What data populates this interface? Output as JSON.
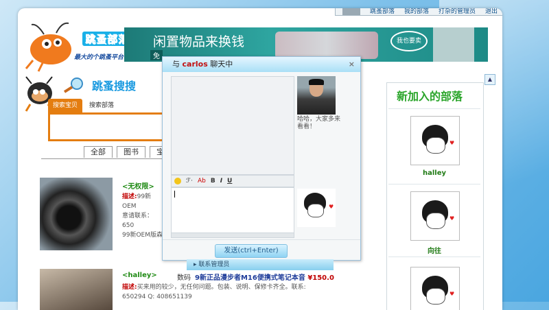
{
  "topnav": {
    "items": [
      "跳蚤部落",
      "我的部落",
      "打杂的管理员",
      "退出"
    ]
  },
  "header": {
    "logo_title": "跳蚤部落",
    "logo_sub": "最大的个跳蚤平台",
    "banner_text": "闲置物品来换钱",
    "banner_sub": "免",
    "banner_button": "我也要卖"
  },
  "search": {
    "title": "跳蚤搜搜",
    "tabs": [
      "搜索宝贝",
      "搜索部落"
    ]
  },
  "category_tabs": [
    "全部",
    "图书",
    "宝马"
  ],
  "items": [
    {
      "user": "<无权限>",
      "desc_label": "描述:",
      "desc_text": "99新OEM",
      "contact": "意请联系：650",
      "footer": "99新OEM版森"
    },
    {
      "user": "<halley>",
      "prefix": "数码",
      "title": "9新正品漫步者M16便携式笔记本音",
      "price": "¥150.0",
      "desc_label": "描述:",
      "desc_text": "买来用的较少，无任何问题。包装、说明、保修卡齐全。联系:",
      "contact": "650294 Q: 408651139"
    }
  ],
  "right_panel": {
    "title": "新加入的部落",
    "members": [
      "halley",
      "向往",
      ""
    ]
  },
  "chat": {
    "title_prefix": "与",
    "username": "carlos",
    "title_suffix": "聊天中",
    "close": "×",
    "peer_message": "哈哈，大家多来看看！",
    "toolbar": [
      "ℱ·",
      "Ab",
      "B",
      "I",
      "U"
    ],
    "send_button": "发送(ctrl+Enter)"
  },
  "contact_manager": "▸ 联系管理员"
}
